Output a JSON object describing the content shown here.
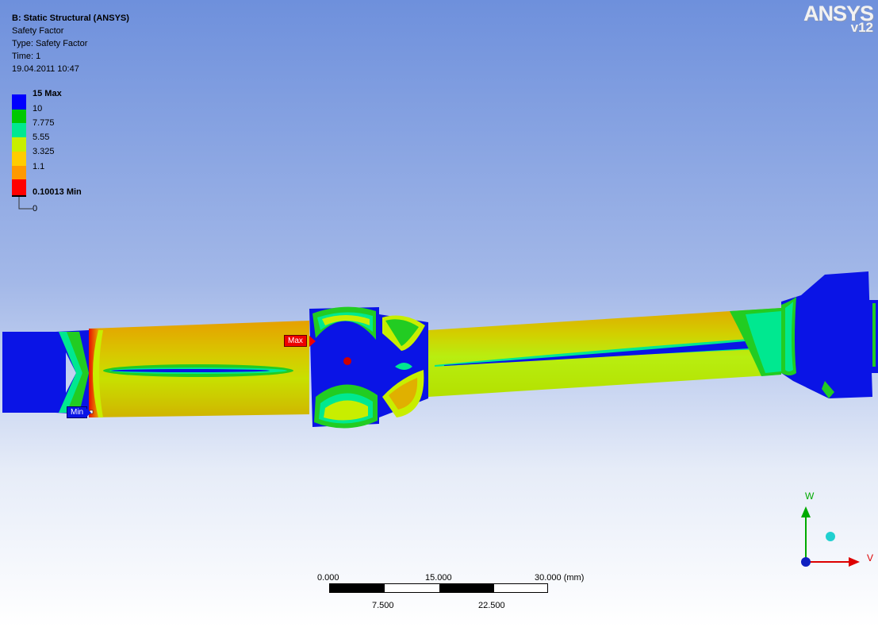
{
  "header": {
    "title": "B: Static Structural (ANSYS)",
    "result": "Safety Factor",
    "type": "Type: Safety Factor",
    "time": "Time: 1",
    "date": "19.04.2011 10:47"
  },
  "logo": {
    "brand": "ANSYS",
    "version": "v12"
  },
  "legend": {
    "labels": [
      "15 Max",
      "10",
      "7.775",
      "5.55",
      "3.325",
      "1.1",
      "0.10013 Min",
      "0"
    ],
    "colors": [
      "#0000ff",
      "#00c800",
      "#00e890",
      "#c8ee00",
      "#ffcc00",
      "#ff9900",
      "#ff0000"
    ]
  },
  "probes": {
    "max_label": "Max",
    "min_label": "Min",
    "max_color": "#ff0000",
    "min_color": "#0000ff"
  },
  "scale_bar": {
    "top_labels": [
      "0.000",
      "15.000",
      "30.000 (mm)"
    ],
    "bottom_labels": [
      "7.500",
      "22.500"
    ]
  },
  "triad": {
    "axis_up": "W",
    "axis_right": "V",
    "up_color": "#00aa00",
    "right_color": "#dd0000"
  },
  "contour_colors": {
    "blue": "#0a14e6",
    "green": "#22cc22",
    "cyan": "#00e890",
    "yellow": "#c8ee00",
    "orange": "#e6b400",
    "red": "#ff0000"
  }
}
